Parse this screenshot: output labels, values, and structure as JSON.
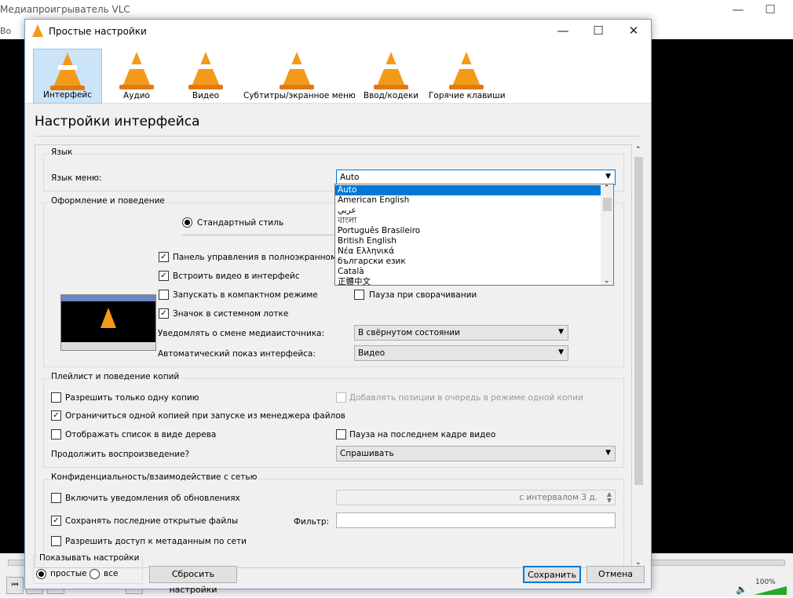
{
  "background_app": {
    "title": "Медиапроигрыватель VLC",
    "menu_fragment": "Во",
    "controls": {
      "minimize": "—",
      "maximize": "☐"
    },
    "volume": "100%"
  },
  "dialog": {
    "title": "Простые настройки",
    "window_controls": {
      "minimize": "—",
      "maximize": "☐",
      "close": "✕"
    },
    "tabs": [
      {
        "label": "Интерфейс",
        "selected": true
      },
      {
        "label": "Аудио"
      },
      {
        "label": "Видео"
      },
      {
        "label": "Субтитры/экранное меню"
      },
      {
        "label": "Ввод/кодеки"
      },
      {
        "label": "Горячие клавиши"
      }
    ],
    "heading": "Настройки интерфейса",
    "language": {
      "group": "Язык",
      "menu_language_label": "Язык меню:",
      "menu_language_value": "Auto",
      "dropdown_options": [
        "Auto",
        "American English",
        "عربي",
        "বাংলা",
        "Português Brasileiro",
        "British English",
        "Νέα Ελληνικά",
        "български език",
        "Català",
        "正體中文"
      ]
    },
    "look": {
      "group": "Оформление и поведение",
      "native_style": "Стандартный стиль",
      "fullscreen_controller": "Панель управления в полноэкранном реж",
      "embed_video": "Встроить видео в интерфейс",
      "minimal_view": "Запускать в компактном режиме",
      "pause_minimized": "Пауза при сворачивании",
      "systray": "Значок в системном лотке",
      "notify_label": "Уведомлять о смене медиаисточника:",
      "notify_value": "В свёрнутом состоянии",
      "autoraise_label": "Автоматический показ интерфейса:",
      "autoraise_value": "Видео"
    },
    "playlist": {
      "group": "Плейлист и поведение копий",
      "one_instance": "Разрешить только одну копию",
      "enqueue": "Добавлять позиции в очередь в режиме одной копии",
      "one_instance_fm": "Ограничиться одной копией при запуске из менеджера файлов",
      "tree_view": "Отображать список в виде дерева",
      "pause_last": "Пауза на последнем кадре видео",
      "continue_label": "Продолжить воспроизведение?",
      "continue_value": "Спрашивать"
    },
    "privacy": {
      "group": "Конфиденциальность/взаимодействие с сетью",
      "updates": "Включить уведомления об обновлениях",
      "interval": "с интервалом 3 д.",
      "recent": "Сохранять последние открытые файлы",
      "filter_label": "Фильтр:",
      "filter_value": "",
      "metadata": "Разрешить доступ к метаданным по сети"
    },
    "footer": {
      "show_settings": "Показывать настройки",
      "simple": "простые",
      "all": "все",
      "reset": "Сбросить настройки",
      "save": "Сохранить",
      "cancel": "Отмена"
    }
  },
  "colors": {
    "accent": "#0078d7",
    "selected_tab": "#cce4f7",
    "cone": "#f39a1a"
  }
}
